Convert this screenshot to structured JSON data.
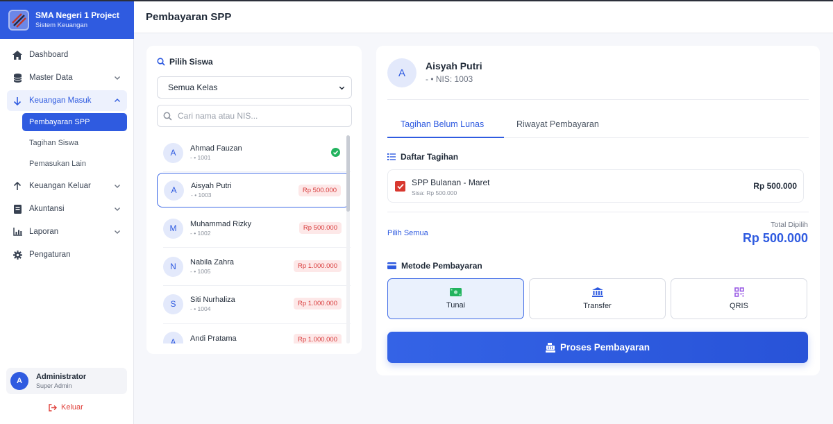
{
  "app": {
    "brand_title": "SMA Negeri 1 Project",
    "brand_subtitle": "Sistem Keuangan"
  },
  "header": {
    "title": "Pembayaran SPP"
  },
  "sidebar": {
    "items": [
      {
        "label": "Dashboard",
        "icon": "home-icon"
      },
      {
        "label": "Master Data",
        "icon": "database-icon"
      },
      {
        "label": "Keuangan Masuk",
        "icon": "arrow-down-icon"
      },
      {
        "label": "Keuangan Keluar",
        "icon": "arrow-up-icon"
      },
      {
        "label": "Akuntansi",
        "icon": "book-icon"
      },
      {
        "label": "Laporan",
        "icon": "chart-icon"
      },
      {
        "label": "Pengaturan",
        "icon": "gear-icon"
      }
    ],
    "sub_items": [
      "Pembayaran SPP",
      "Tagihan Siswa",
      "Pemasukan Lain"
    ],
    "user": {
      "initial": "A",
      "name": "Administrator",
      "role": "Super Admin"
    },
    "logout_label": "Keluar"
  },
  "student_panel": {
    "title": "Pilih Siswa",
    "class_select": "Semua Kelas",
    "search_placeholder": "Cari nama atau NIS...",
    "students": [
      {
        "initial": "A",
        "name": "Ahmad Fauzan",
        "meta": "- • 1001",
        "badge": "",
        "paid": true
      },
      {
        "initial": "A",
        "name": "Aisyah Putri",
        "meta": "- • 1003",
        "badge": "Rp 500.000",
        "paid": false
      },
      {
        "initial": "M",
        "name": "Muhammad Rizky",
        "meta": "- • 1002",
        "badge": "Rp 500.000",
        "paid": false
      },
      {
        "initial": "N",
        "name": "Nabila Zahra",
        "meta": "- • 1005",
        "badge": "Rp 1.000.000",
        "paid": false
      },
      {
        "initial": "S",
        "name": "Siti Nurhaliza",
        "meta": "- • 1004",
        "badge": "Rp 1.000.000",
        "paid": false
      },
      {
        "initial": "A",
        "name": "Andi Pratama",
        "meta": "",
        "badge": "Rp 1.000.000",
        "paid": false
      }
    ]
  },
  "detail": {
    "initial": "A",
    "name": "Aisyah Putri",
    "nis": "- • NIS: 1003",
    "tabs": [
      "Tagihan Belum Lunas",
      "Riwayat Pembayaran"
    ],
    "bills_title": "Daftar Tagihan",
    "bill": {
      "name": "SPP Bulanan - Maret",
      "sisa": "Sisa: Rp 500.000",
      "amount": "Rp 500.000"
    },
    "select_all": "Pilih Semua",
    "total_label": "Total Dipilih",
    "total_value": "Rp 500.000",
    "method_title": "Metode Pembayaran",
    "methods": [
      {
        "label": "Tunai",
        "icon": "cash-icon"
      },
      {
        "label": "Transfer",
        "icon": "bank-icon"
      },
      {
        "label": "QRIS",
        "icon": "qr-icon"
      }
    ],
    "process_label": "Proses Pembayaran"
  },
  "colors": {
    "primary": "#2f5be0",
    "danger": "#d8382f",
    "success": "#22b35e",
    "qris": "#9b5de5"
  }
}
